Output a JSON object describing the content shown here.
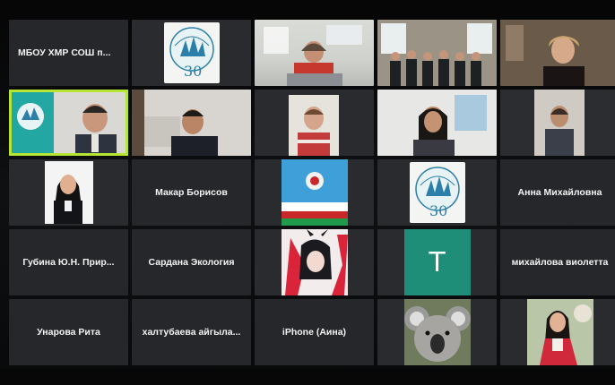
{
  "participants": {
    "mbou_khmr": "МБОУ ХМР СОШ п...",
    "makar_borisov": "Макар Борисов",
    "anna_mikhailovna": "Анна Михайловна",
    "gubina": "Губина Ю.Н. Прир...",
    "sardana": "Сардана Экология",
    "initial_letter": "T",
    "mikhailova": "михайлова виолетта",
    "unarova": "Унарова Рита",
    "khaltubaeva": "халтубаева айгыла...",
    "iphone_aina": "iPhone (Аина)"
  },
  "colors": {
    "active_speaker_border": "#b7e533",
    "initial_avatar_bg": "#1f8e78",
    "tile_bg": "#26272a"
  },
  "icons": {
    "logo": "northern-forum-logo"
  }
}
